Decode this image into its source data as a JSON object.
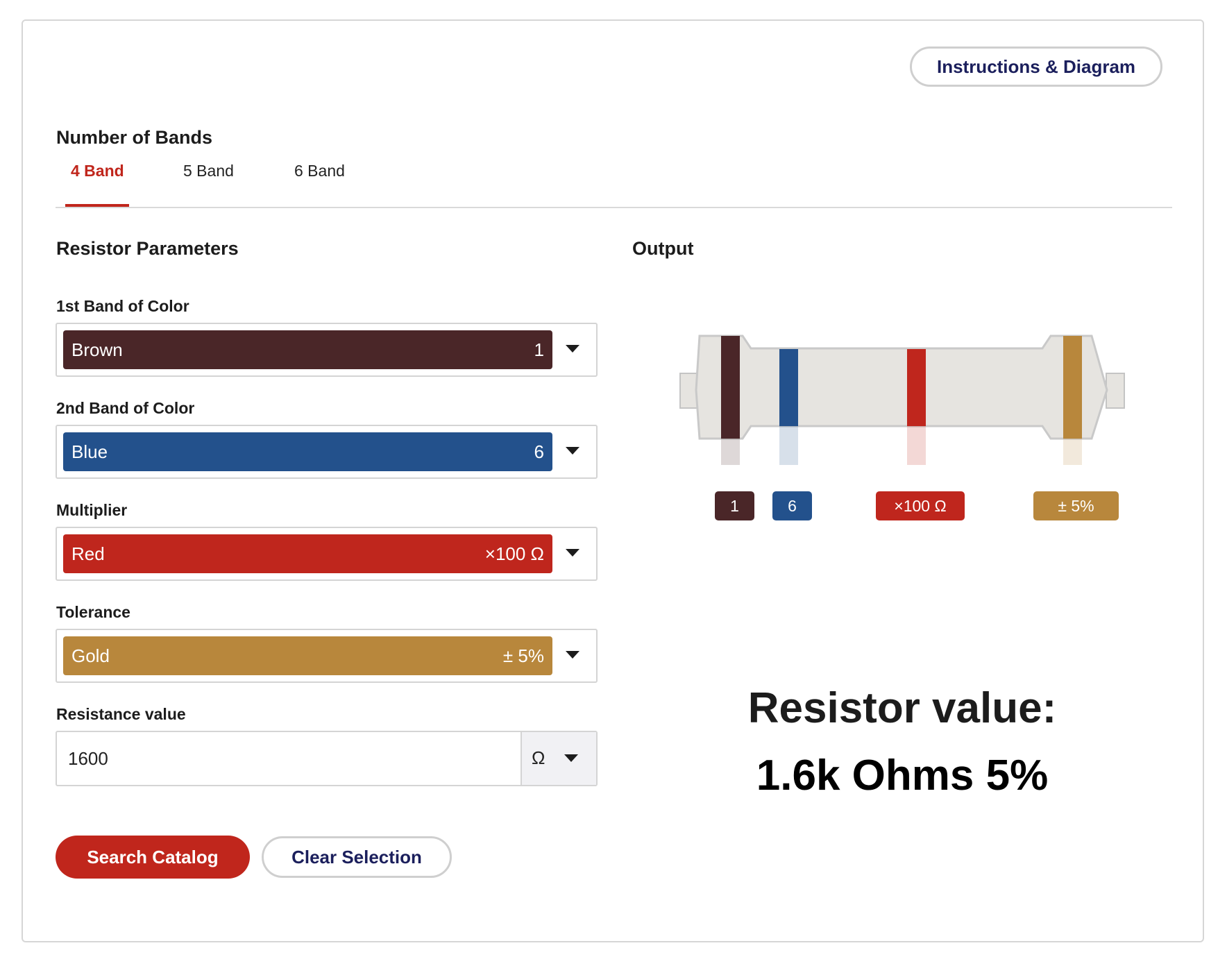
{
  "header": {
    "instructions_button": "Instructions & Diagram"
  },
  "bands": {
    "heading": "Number of Bands",
    "tabs": [
      {
        "label": "4 Band",
        "active": true
      },
      {
        "label": "5 Band",
        "active": false
      },
      {
        "label": "6 Band",
        "active": false
      }
    ]
  },
  "params": {
    "heading": "Resistor Parameters",
    "band1": {
      "label": "1st Band of Color",
      "color_name": "Brown",
      "value": "1",
      "color": "#4a2628"
    },
    "band2": {
      "label": "2nd Band of Color",
      "color_name": "Blue",
      "value": "6",
      "color": "#23518c"
    },
    "multiplier": {
      "label": "Multiplier",
      "color_name": "Red",
      "value": "×100 Ω",
      "color": "#bf261d"
    },
    "tolerance": {
      "label": "Tolerance",
      "color_name": "Gold",
      "value": "± 5%",
      "color": "#b8873c"
    },
    "resistance": {
      "label": "Resistance value",
      "value": "1600",
      "unit": "Ω"
    }
  },
  "buttons": {
    "search": "Search Catalog",
    "clear": "Clear Selection"
  },
  "output": {
    "heading": "Output",
    "tags": [
      "1",
      "6",
      "×100 Ω",
      "± 5%"
    ],
    "result_title": "Resistor value:",
    "result_value": "1.6k Ohms 5%"
  },
  "colors": {
    "accent": "#c0261c",
    "navy": "#1b1f5c"
  }
}
